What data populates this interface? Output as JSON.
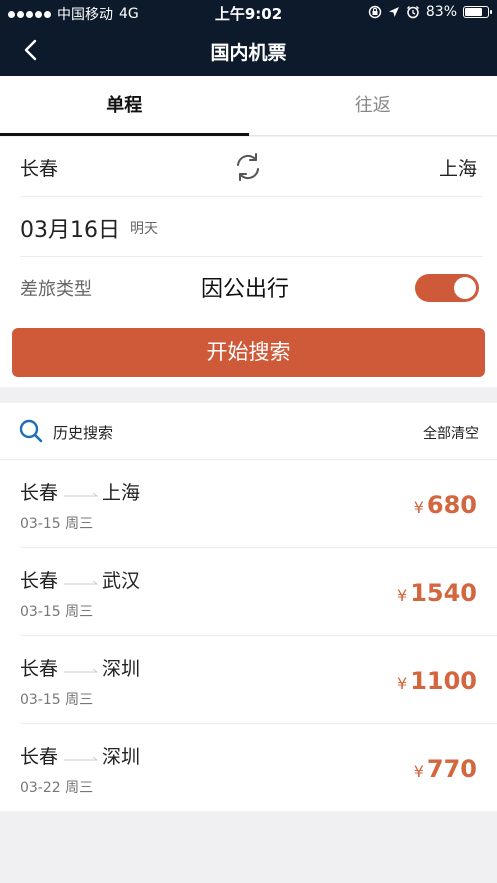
{
  "status_bar": {
    "carrier": "中国移动",
    "network": "4G",
    "time": "上午9:02",
    "battery": "83%",
    "battery_level": 0.83
  },
  "nav": {
    "back_icon": "chevron-left-icon",
    "title": "国内机票"
  },
  "tabs": [
    {
      "label": "单程",
      "active": true
    },
    {
      "label": "往返",
      "active": false
    }
  ],
  "form": {
    "from_city": "长春",
    "to_city": "上海",
    "swap_icon": "swap-refresh-icon",
    "date": "03月16日",
    "date_note": "明天",
    "trip_type_label": "差旅类型",
    "trip_type_value": "因公出行",
    "trip_toggle_on": true,
    "search_button": "开始搜索"
  },
  "history": {
    "icon": "search-icon",
    "title": "历史搜索",
    "clear": "全部清空",
    "currency": "¥",
    "items": [
      {
        "from": "长春",
        "to": "上海",
        "date": "03-15  周三",
        "price": "680"
      },
      {
        "from": "长春",
        "to": "武汉",
        "date": "03-15  周三",
        "price": "1540"
      },
      {
        "from": "长春",
        "to": "深圳",
        "date": "03-15  周三",
        "price": "1100"
      },
      {
        "from": "长春",
        "to": "深圳",
        "date": "03-22  周三",
        "price": "770"
      }
    ]
  },
  "colors": {
    "header_bg": "#0c1a2b",
    "accent": "#cf5a3a",
    "price": "#d3663f"
  }
}
